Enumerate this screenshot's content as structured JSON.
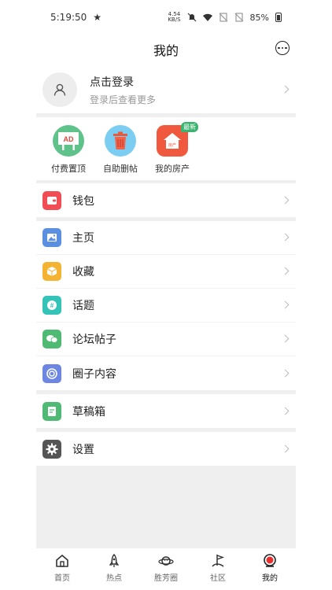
{
  "status": {
    "time": "5:19:50",
    "net_speed": "4.54",
    "net_unit": "KB/S",
    "battery": "85%"
  },
  "header": {
    "title": "我的"
  },
  "login": {
    "title": "点击登录",
    "subtitle": "登录后查看更多"
  },
  "quick_actions": [
    {
      "label": "付费置顶",
      "icon_text": "AD",
      "icon": "billboard-icon",
      "color": "#5ec28a"
    },
    {
      "label": "自助删帖",
      "icon": "trash-icon",
      "color": "#7ccdf2"
    },
    {
      "label": "我的房产",
      "icon": "house-icon",
      "color": "#f0593e",
      "badge": "最新",
      "icon_text": "房产"
    }
  ],
  "menu": {
    "wallet": {
      "label": "钱包",
      "icon": "wallet-icon",
      "color": "#f04d55"
    },
    "home": {
      "label": "主页",
      "icon": "image-icon",
      "color": "#5b8fe0"
    },
    "favorites": {
      "label": "收藏",
      "icon": "box-icon",
      "color": "#f5b334"
    },
    "topics": {
      "label": "话题",
      "icon": "hashtag-icon",
      "color": "#34c3b7"
    },
    "posts": {
      "label": "论坛帖子",
      "icon": "chat-icon",
      "color": "#4fba73"
    },
    "circle": {
      "label": "圈子内容",
      "icon": "circle-icon",
      "color": "#6c86e2"
    },
    "drafts": {
      "label": "草稿箱",
      "icon": "draft-icon",
      "color": "#4fba73"
    },
    "settings": {
      "label": "设置",
      "icon": "gear-icon",
      "color": "#555555"
    }
  },
  "tabs": [
    {
      "label": "首页",
      "icon": "home-icon"
    },
    {
      "label": "热点",
      "icon": "rocket-icon"
    },
    {
      "label": "胜芳圈",
      "icon": "planet-icon"
    },
    {
      "label": "社区",
      "icon": "flag-icon"
    },
    {
      "label": "我的",
      "icon": "profile-icon",
      "active": true
    }
  ]
}
